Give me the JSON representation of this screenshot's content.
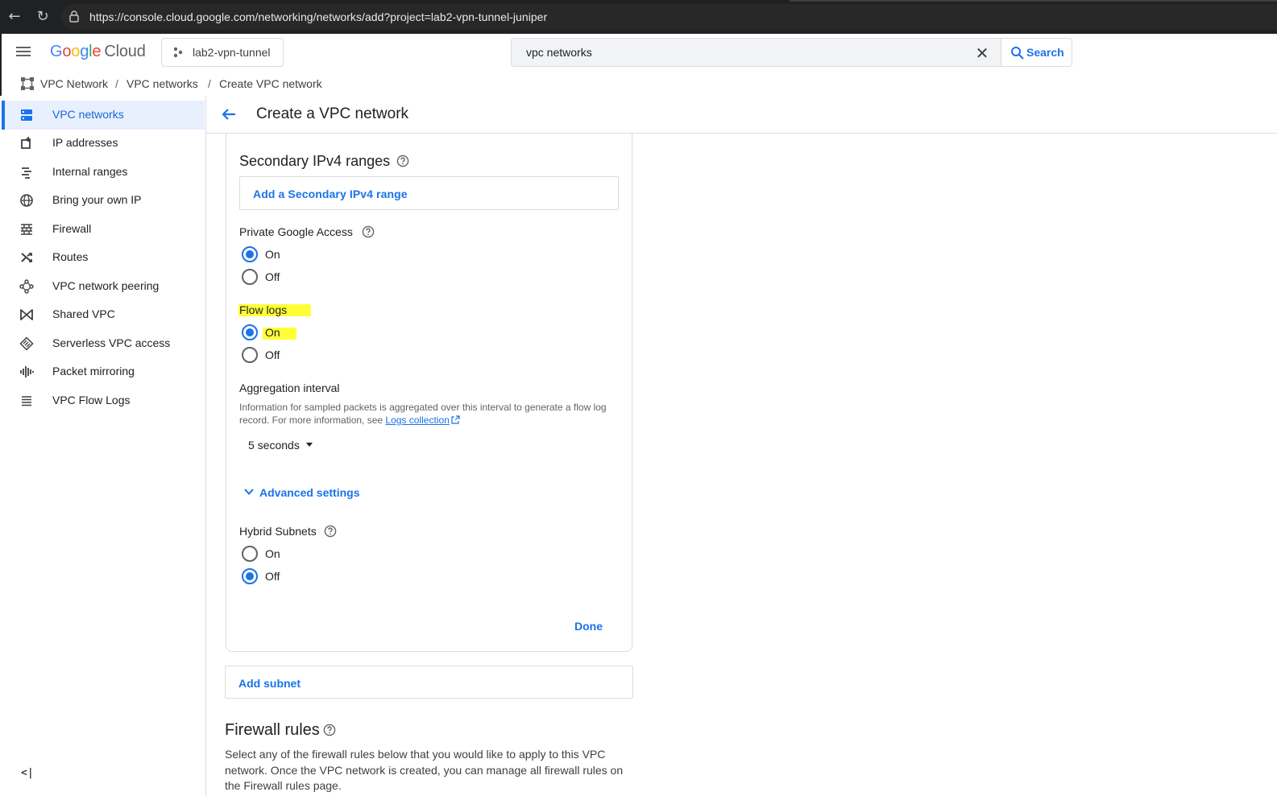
{
  "browser": {
    "url": "https://console.cloud.google.com/networking/networks/add?project=lab2-vpn-tunnel-juniper"
  },
  "header": {
    "logo_google": [
      "G",
      "o",
      "o",
      "g",
      "l",
      "e"
    ],
    "logo_cloud": "Cloud",
    "project_name": "lab2-vpn-tunnel",
    "search_value": "vpc networks",
    "search_button_label": "Search"
  },
  "breadcrumb": {
    "items": [
      "VPC Network",
      "VPC networks",
      "Create VPC network"
    ],
    "separator": "/"
  },
  "sidebar": {
    "items": [
      {
        "label": "VPC networks",
        "icon": "vpc-networks-icon",
        "active": true
      },
      {
        "label": "IP addresses",
        "icon": "ip-addresses-icon"
      },
      {
        "label": "Internal ranges",
        "icon": "internal-ranges-icon"
      },
      {
        "label": "Bring your own IP",
        "icon": "globe-icon"
      },
      {
        "label": "Firewall",
        "icon": "firewall-icon"
      },
      {
        "label": "Routes",
        "icon": "routes-icon"
      },
      {
        "label": "VPC network peering",
        "icon": "peering-icon"
      },
      {
        "label": "Shared VPC",
        "icon": "shared-vpc-icon"
      },
      {
        "label": "Serverless VPC access",
        "icon": "serverless-icon"
      },
      {
        "label": "Packet mirroring",
        "icon": "packet-mirroring-icon"
      },
      {
        "label": "VPC Flow Logs",
        "icon": "flow-logs-icon"
      }
    ],
    "collapse_label": "<|"
  },
  "page": {
    "title": "Create a VPC network"
  },
  "subnet_card": {
    "secondary_ranges_title": "Secondary IPv4 ranges",
    "add_secondary_range_label": "Add a Secondary IPv4 range",
    "private_google_access": {
      "label": "Private Google Access",
      "options": [
        "On",
        "Off"
      ],
      "selected": "On"
    },
    "flow_logs": {
      "label": "Flow logs",
      "options": [
        "On",
        "Off"
      ],
      "selected": "On"
    },
    "aggregation_interval": {
      "label": "Aggregation interval",
      "info_prefix": "Information for sampled packets is aggregated over this interval to generate a flow log record. For more information, see ",
      "info_link": "Logs collection",
      "value": "5 seconds"
    },
    "advanced_settings_label": "Advanced settings",
    "hybrid_subnets": {
      "label": "Hybrid Subnets",
      "options": [
        "On",
        "Off"
      ],
      "selected": "Off"
    },
    "done_label": "Done"
  },
  "add_subnet_label": "Add subnet",
  "firewall": {
    "title": "Firewall rules",
    "description": "Select any of the firewall rules below that you would like to apply to this VPC network. Once the VPC network is created, you can manage all firewall rules on the Firewall rules page."
  },
  "colors": {
    "accent": "#1a73e8",
    "active_nav_bg": "#e8f0fe",
    "highlight": "#ffff38",
    "browser_bar": "#202124"
  }
}
